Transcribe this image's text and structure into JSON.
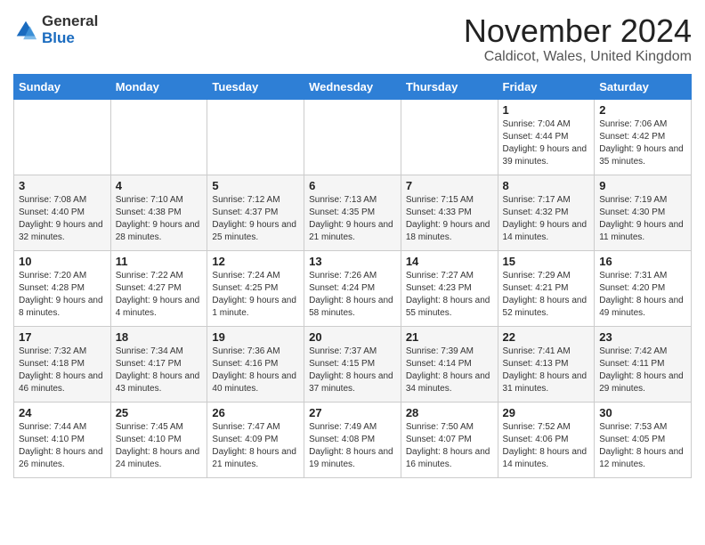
{
  "logo": {
    "general": "General",
    "blue": "Blue"
  },
  "header": {
    "month": "November 2024",
    "location": "Caldicot, Wales, United Kingdom"
  },
  "days_of_week": [
    "Sunday",
    "Monday",
    "Tuesday",
    "Wednesday",
    "Thursday",
    "Friday",
    "Saturday"
  ],
  "weeks": [
    [
      {
        "day": "",
        "info": ""
      },
      {
        "day": "",
        "info": ""
      },
      {
        "day": "",
        "info": ""
      },
      {
        "day": "",
        "info": ""
      },
      {
        "day": "",
        "info": ""
      },
      {
        "day": "1",
        "info": "Sunrise: 7:04 AM\nSunset: 4:44 PM\nDaylight: 9 hours and 39 minutes."
      },
      {
        "day": "2",
        "info": "Sunrise: 7:06 AM\nSunset: 4:42 PM\nDaylight: 9 hours and 35 minutes."
      }
    ],
    [
      {
        "day": "3",
        "info": "Sunrise: 7:08 AM\nSunset: 4:40 PM\nDaylight: 9 hours and 32 minutes."
      },
      {
        "day": "4",
        "info": "Sunrise: 7:10 AM\nSunset: 4:38 PM\nDaylight: 9 hours and 28 minutes."
      },
      {
        "day": "5",
        "info": "Sunrise: 7:12 AM\nSunset: 4:37 PM\nDaylight: 9 hours and 25 minutes."
      },
      {
        "day": "6",
        "info": "Sunrise: 7:13 AM\nSunset: 4:35 PM\nDaylight: 9 hours and 21 minutes."
      },
      {
        "day": "7",
        "info": "Sunrise: 7:15 AM\nSunset: 4:33 PM\nDaylight: 9 hours and 18 minutes."
      },
      {
        "day": "8",
        "info": "Sunrise: 7:17 AM\nSunset: 4:32 PM\nDaylight: 9 hours and 14 minutes."
      },
      {
        "day": "9",
        "info": "Sunrise: 7:19 AM\nSunset: 4:30 PM\nDaylight: 9 hours and 11 minutes."
      }
    ],
    [
      {
        "day": "10",
        "info": "Sunrise: 7:20 AM\nSunset: 4:28 PM\nDaylight: 9 hours and 8 minutes."
      },
      {
        "day": "11",
        "info": "Sunrise: 7:22 AM\nSunset: 4:27 PM\nDaylight: 9 hours and 4 minutes."
      },
      {
        "day": "12",
        "info": "Sunrise: 7:24 AM\nSunset: 4:25 PM\nDaylight: 9 hours and 1 minute."
      },
      {
        "day": "13",
        "info": "Sunrise: 7:26 AM\nSunset: 4:24 PM\nDaylight: 8 hours and 58 minutes."
      },
      {
        "day": "14",
        "info": "Sunrise: 7:27 AM\nSunset: 4:23 PM\nDaylight: 8 hours and 55 minutes."
      },
      {
        "day": "15",
        "info": "Sunrise: 7:29 AM\nSunset: 4:21 PM\nDaylight: 8 hours and 52 minutes."
      },
      {
        "day": "16",
        "info": "Sunrise: 7:31 AM\nSunset: 4:20 PM\nDaylight: 8 hours and 49 minutes."
      }
    ],
    [
      {
        "day": "17",
        "info": "Sunrise: 7:32 AM\nSunset: 4:18 PM\nDaylight: 8 hours and 46 minutes."
      },
      {
        "day": "18",
        "info": "Sunrise: 7:34 AM\nSunset: 4:17 PM\nDaylight: 8 hours and 43 minutes."
      },
      {
        "day": "19",
        "info": "Sunrise: 7:36 AM\nSunset: 4:16 PM\nDaylight: 8 hours and 40 minutes."
      },
      {
        "day": "20",
        "info": "Sunrise: 7:37 AM\nSunset: 4:15 PM\nDaylight: 8 hours and 37 minutes."
      },
      {
        "day": "21",
        "info": "Sunrise: 7:39 AM\nSunset: 4:14 PM\nDaylight: 8 hours and 34 minutes."
      },
      {
        "day": "22",
        "info": "Sunrise: 7:41 AM\nSunset: 4:13 PM\nDaylight: 8 hours and 31 minutes."
      },
      {
        "day": "23",
        "info": "Sunrise: 7:42 AM\nSunset: 4:11 PM\nDaylight: 8 hours and 29 minutes."
      }
    ],
    [
      {
        "day": "24",
        "info": "Sunrise: 7:44 AM\nSunset: 4:10 PM\nDaylight: 8 hours and 26 minutes."
      },
      {
        "day": "25",
        "info": "Sunrise: 7:45 AM\nSunset: 4:10 PM\nDaylight: 8 hours and 24 minutes."
      },
      {
        "day": "26",
        "info": "Sunrise: 7:47 AM\nSunset: 4:09 PM\nDaylight: 8 hours and 21 minutes."
      },
      {
        "day": "27",
        "info": "Sunrise: 7:49 AM\nSunset: 4:08 PM\nDaylight: 8 hours and 19 minutes."
      },
      {
        "day": "28",
        "info": "Sunrise: 7:50 AM\nSunset: 4:07 PM\nDaylight: 8 hours and 16 minutes."
      },
      {
        "day": "29",
        "info": "Sunrise: 7:52 AM\nSunset: 4:06 PM\nDaylight: 8 hours and 14 minutes."
      },
      {
        "day": "30",
        "info": "Sunrise: 7:53 AM\nSunset: 4:05 PM\nDaylight: 8 hours and 12 minutes."
      }
    ]
  ]
}
